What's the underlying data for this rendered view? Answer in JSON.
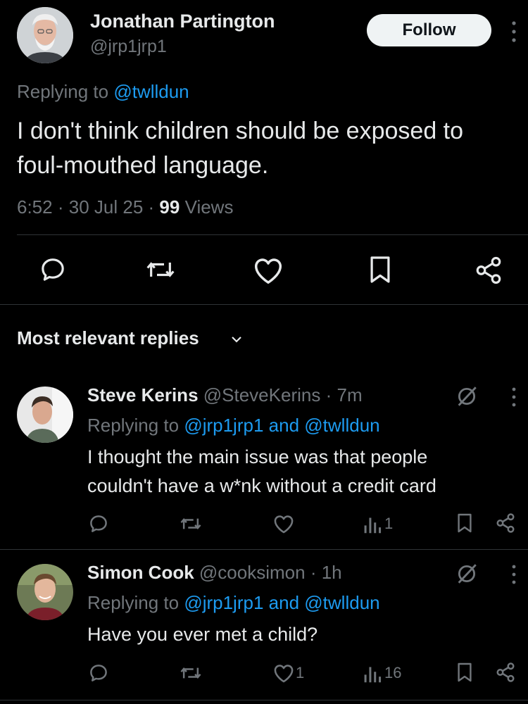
{
  "tweet": {
    "author_name": "Jonathan Partington",
    "author_handle": "@jrp1jrp1",
    "follow_label": "Follow",
    "replying_prefix": "Replying to",
    "replying_to": "@twlldun",
    "text_line1": "I don't think children should be exposed to",
    "text_line2": "foul-mouthed language.",
    "time": "6:52",
    "sep1": "·",
    "date": "30 Jul 25",
    "sep2": "·",
    "views_count": "99",
    "views_label": "Views"
  },
  "actions": {
    "icons": [
      "reply-icon",
      "retweet-icon",
      "like-icon",
      "bookmark-icon",
      "share-icon"
    ]
  },
  "replies_header": {
    "label": "Most relevant replies"
  },
  "replies": [
    {
      "name": "Steve Kerins",
      "handle": "@SteveKerins",
      "sep": "·",
      "time": "7m",
      "replying_prefix": "Replying to",
      "mention1": "@jrp1jrp1",
      "and": "and",
      "mention2": "@twlldun",
      "text_line1": "I thought the main issue was that people",
      "text_line2": "couldn't have a w*nk without a credit card",
      "likes": "",
      "views": "1"
    },
    {
      "name": "Simon Cook",
      "handle": "@cooksimon",
      "sep": "·",
      "time": "1h",
      "replying_prefix": "Replying to",
      "mention1": "@jrp1jrp1",
      "and": "and",
      "mention2": "@twlldun",
      "text_line1": "Have you ever met a child?",
      "likes": "1",
      "views": "16"
    }
  ],
  "colors": {
    "background": "#000000",
    "text": "#e7e9ea",
    "muted": "#71767b",
    "link": "#1d9bf0",
    "follow_bg": "#eff3f4"
  }
}
